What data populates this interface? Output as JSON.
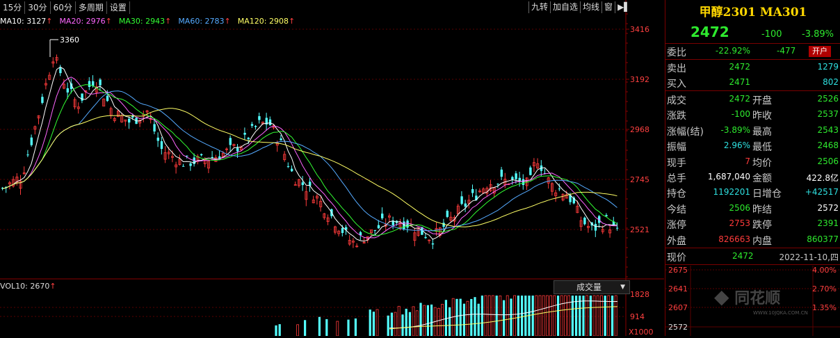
{
  "toolbar": {
    "periods": [
      "15分",
      "30分",
      "60分",
      "多周期",
      "设置"
    ],
    "tools": [
      "九转",
      "加自选",
      "均线",
      "窗"
    ]
  },
  "ma_legend": [
    {
      "label": "MA10: 3127",
      "color": "#ffffff"
    },
    {
      "label": "MA20: 2976",
      "color": "#ff66ff"
    },
    {
      "label": "MA30: 2943",
      "color": "#33ff33"
    },
    {
      "label": "MA60: 2783",
      "color": "#55aaff"
    },
    {
      "label": "MA120: 2908",
      "color": "#ffff66"
    }
  ],
  "max_label": "3360",
  "price_axis": [
    "3416",
    "3192",
    "2968",
    "2745",
    "2521"
  ],
  "volume": {
    "header": "VOL10: 2670",
    "selector": "成交量",
    "axis": [
      "1828",
      "914",
      "X1000"
    ]
  },
  "quote": {
    "title": "甲醇2301 MA301",
    "price": "2472",
    "change": "-100",
    "pct": "-3.89%",
    "weibi": {
      "label": "委比",
      "pct": "-22.92%",
      "diff": "-477",
      "button": "开户"
    },
    "sell": {
      "label": "卖出",
      "price": "2472",
      "vol": "1279"
    },
    "buy": {
      "label": "买入",
      "price": "2471",
      "vol": "802"
    },
    "rows": [
      {
        "l1": "成交",
        "v1": "2472",
        "c1": "g",
        "l2": "开盘",
        "v2": "2526",
        "c2": "g"
      },
      {
        "l1": "涨跌",
        "v1": "-100",
        "c1": "g",
        "l2": "昨收",
        "v2": "2537",
        "c2": "g"
      },
      {
        "l1": "涨幅(结)",
        "v1": "-3.89%",
        "c1": "g",
        "l2": "最高",
        "v2": "2543",
        "c2": "g"
      },
      {
        "l1": "振幅",
        "v1": "2.96%",
        "c1": "c",
        "l2": "最低",
        "v2": "2468",
        "c2": "g"
      },
      {
        "l1": "现手",
        "v1": "7",
        "c1": "r",
        "l2": "均价",
        "v2": "2506",
        "c2": "g"
      },
      {
        "l1": "总手",
        "v1": "1,687,040",
        "c1": "w",
        "l2": "金额",
        "v2": "422.8亿",
        "c2": "w"
      },
      {
        "l1": "持仓",
        "v1": "1192201",
        "c1": "c",
        "l2": "日增仓",
        "v2": "+42517",
        "c2": "c"
      },
      {
        "l1": "今结",
        "v1": "2506",
        "c1": "g",
        "l2": "昨结",
        "v2": "2572",
        "c2": "w"
      },
      {
        "l1": "涨停",
        "v1": "2753",
        "c1": "r",
        "l2": "跌停",
        "v2": "2391",
        "c2": "g"
      },
      {
        "l1": "外盘",
        "v1": "826663",
        "c1": "r",
        "l2": "内盘",
        "v2": "860377",
        "c2": "g"
      }
    ],
    "now": {
      "label": "现价",
      "price": "2472",
      "date": "2022-11-10,四"
    },
    "mini_prices": [
      "2675",
      "2641",
      "2607",
      "2572"
    ],
    "mini_pcts": [
      "4.00%",
      "2.70%",
      "1.35%"
    ],
    "watermark": "同花顺",
    "watermark_url": "WWW.10JQKA.COM.CN"
  }
}
